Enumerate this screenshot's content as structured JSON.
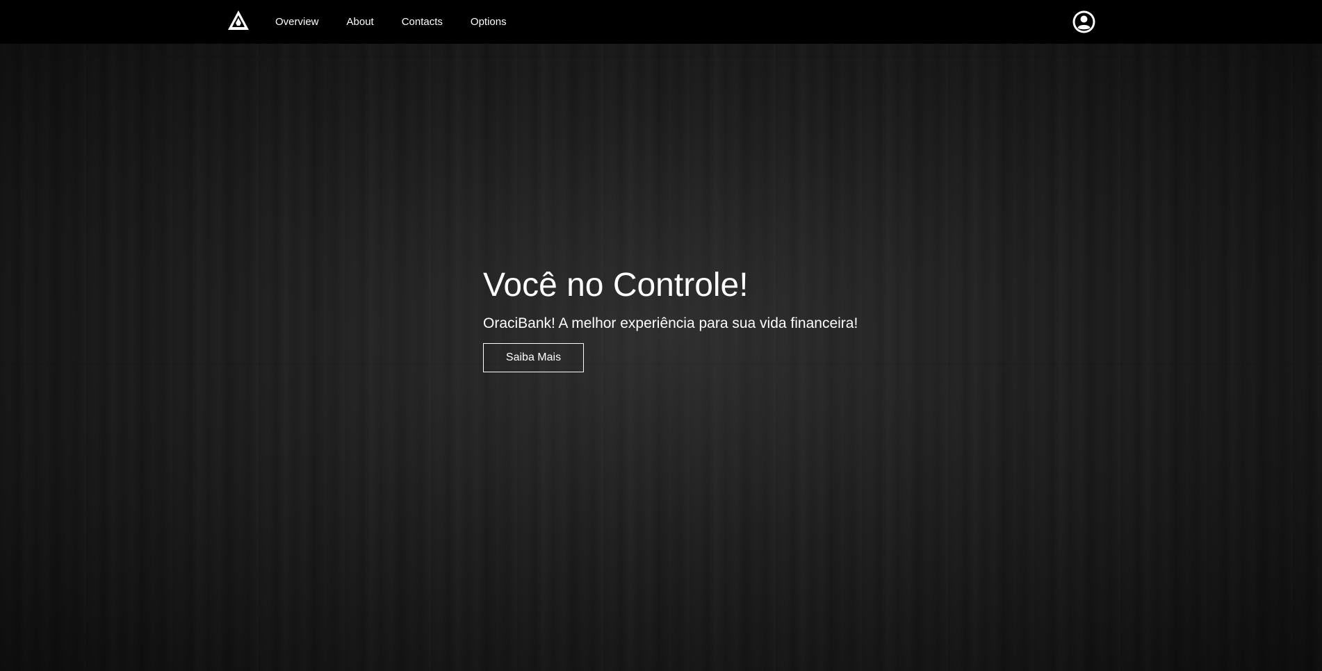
{
  "nav": {
    "items": [
      {
        "label": "Overview"
      },
      {
        "label": "About"
      },
      {
        "label": "Contacts"
      },
      {
        "label": "Options"
      }
    ],
    "logo_icon": "triangle-logo-icon",
    "avatar_icon": "user-avatar-icon"
  },
  "hero": {
    "title": "Você no Controle!",
    "subtitle": "OraciBank! A melhor experiência para sua vida financeira!",
    "button_label": "Saiba Mais"
  },
  "colors": {
    "navbar_bg": "#000000",
    "text": "#ffffff",
    "background": "#1f1f1f"
  }
}
